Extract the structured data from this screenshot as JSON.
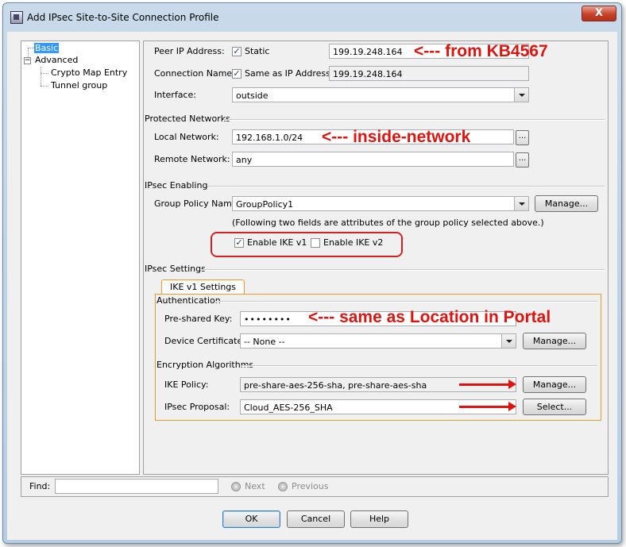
{
  "window": {
    "title": "Add IPsec Site-to-Site Connection Profile",
    "close_glyph": "X"
  },
  "tree": {
    "items": [
      {
        "label": "Basic",
        "selected": true
      },
      {
        "label": "Advanced",
        "expander": "−"
      },
      {
        "label": "Crypto Map Entry"
      },
      {
        "label": "Tunnel group"
      }
    ]
  },
  "basic": {
    "peer_ip_label": "Peer IP Address:",
    "static_label": "Static",
    "static_checked": true,
    "peer_ip_value": "199.19.248.164",
    "conn_name_label": "Connection Name:",
    "same_as_ip_label": "Same as IP Address",
    "same_as_ip_checked": true,
    "conn_name_value": "199.19.248.164",
    "interface_label": "Interface:",
    "interface_value": "outside"
  },
  "protected_networks": {
    "title": "Protected Networks",
    "local_label": "Local Network:",
    "local_value": "192.168.1.0/24",
    "remote_label": "Remote Network:",
    "remote_value": "any",
    "browse_glyph": "..."
  },
  "ipsec_enabling": {
    "title": "IPsec Enabling",
    "group_policy_label": "Group Policy Name:",
    "group_policy_value": "GroupPolicy1",
    "manage_label": "Manage...",
    "note": "(Following two fields are attributes of the group policy selected above.)",
    "ike_v1_label": "Enable IKE v1",
    "ike_v1_checked": true,
    "ike_v2_label": "Enable IKE v2",
    "ike_v2_checked": false
  },
  "ipsec_settings": {
    "title": "IPsec Settings",
    "tab_label": "IKE v1 Settings",
    "auth_title": "Authentication",
    "psk_label": "Pre-shared Key:",
    "psk_value": "••••••••",
    "device_cert_label": "Device Certificate:",
    "device_cert_value": "-- None --",
    "device_cert_manage": "Manage...",
    "enc_title": "Encryption Algorithms",
    "ike_policy_label": "IKE Policy:",
    "ike_policy_value": "pre-share-aes-256-sha, pre-share-aes-sha",
    "ike_policy_manage": "Manage...",
    "ipsec_proposal_label": "IPsec Proposal:",
    "ipsec_proposal_value": "Cloud_AES-256_SHA",
    "ipsec_proposal_select": "Select..."
  },
  "annotations": {
    "peer_ip": "<--- from KB4567",
    "local_network": "<--- inside-network",
    "psk": "<--- same as Location in Portal",
    "color": "#e0140f"
  },
  "find": {
    "label": "Find:",
    "value": "",
    "next_label": "Next",
    "previous_label": "Previous"
  },
  "buttons": {
    "ok": "OK",
    "cancel": "Cancel",
    "help": "Help"
  },
  "colors": {
    "accent_orange": "#f09a2e",
    "selection_blue": "#3399ff",
    "highlight_red": "#d62020"
  }
}
